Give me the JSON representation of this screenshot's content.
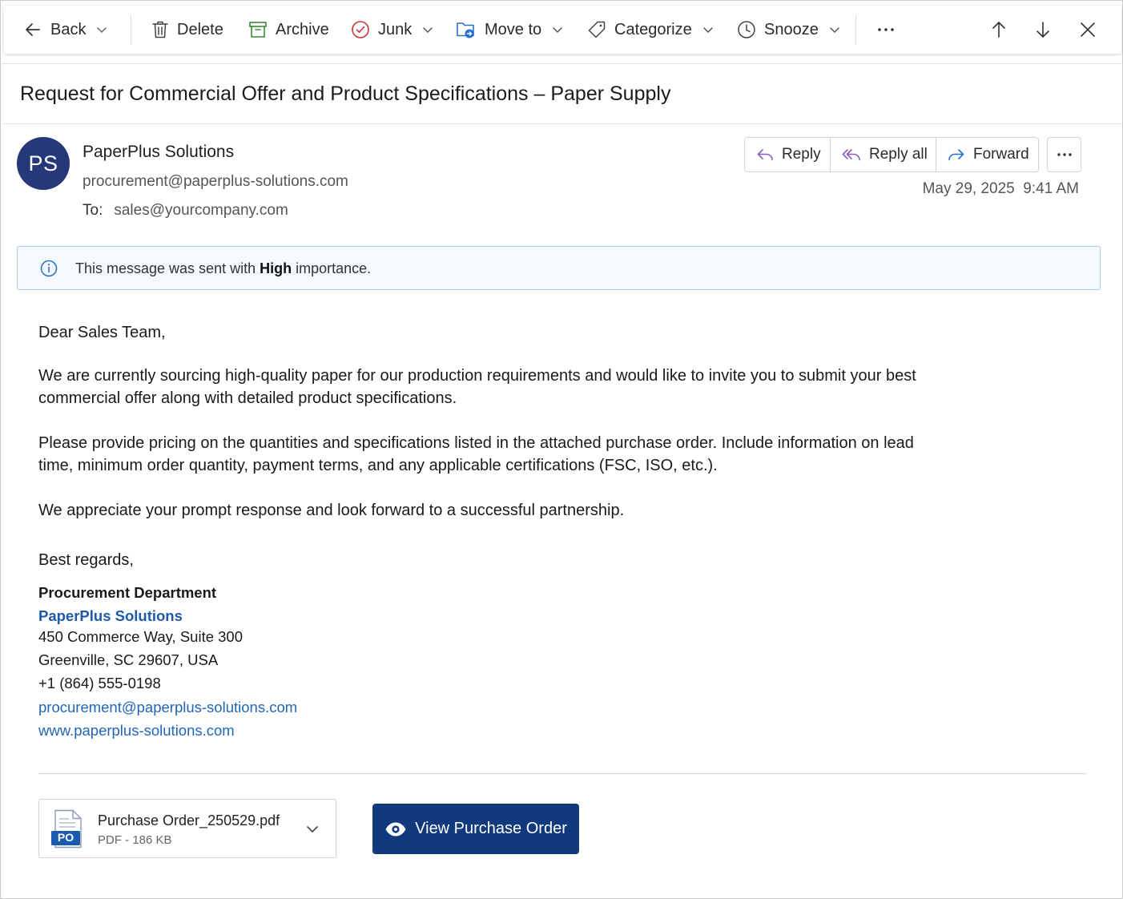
{
  "toolbar": {
    "back_label": "Back",
    "delete_label": "Delete",
    "archive_label": "Archive",
    "junk_label": "Junk",
    "move_label": "Move to",
    "categorize_label": "Categorize",
    "snooze_label": "Snooze"
  },
  "email": {
    "subject": "Request for Commercial Offer and Product Specifications – Paper Supply",
    "avatar_initials": "PS",
    "sender_name": "PaperPlus Solutions",
    "sender_email": "procurement@paperplus-solutions.com",
    "to_label": "To:",
    "to_address": "sales@yourcompany.com",
    "date": "May 29, 2025",
    "time": "9:41 AM",
    "actions": {
      "reply": "Reply",
      "reply_all": "Reply all",
      "forward": "Forward"
    }
  },
  "banner": {
    "prefix": "This message was sent with ",
    "importance": "High",
    "suffix": " importance."
  },
  "body": {
    "greeting": "Dear Sales Team,",
    "paragraph1": "We are currently sourcing high-quality paper for our production requirements and would like to invite you to submit your best commercial offer along with detailed product specifications.",
    "paragraph2": "Please provide pricing on the quantities and specifications listed in the attached purchase order. Include information on lead time, minimum order quantity, payment terms, and any applicable certifications (FSC, ISO, etc.).",
    "paragraph3": "We appreciate your prompt response and look forward to a successful partnership.",
    "closing": "Best regards,"
  },
  "signature": {
    "department": "Procurement Department",
    "company": "PaperPlus Solutions",
    "address1": "450 Commerce Way, Suite 300",
    "address2": "Greenville, SC 29607, USA",
    "phone": "+1 (864) 555-0198",
    "email": "procurement@paperplus-solutions.com",
    "website": "www.paperplus-solutions.com"
  },
  "attachment": {
    "filename": "Purchase Order_250529.pdf",
    "meta": "PDF - 186 KB",
    "badge": "PO"
  },
  "cta": {
    "label": "View Purchase Order"
  },
  "colors": {
    "avatar_bg": "#24387a",
    "cta_bg": "#103a7d",
    "link": "#2166b8",
    "banner_bg": "#f3f9fd",
    "banner_border": "#a8cde6",
    "junk_red": "#d13438",
    "archive_green": "#3a8a3a",
    "move_blue": "#2a6fc9",
    "reply_purple": "#8a5bb8"
  }
}
